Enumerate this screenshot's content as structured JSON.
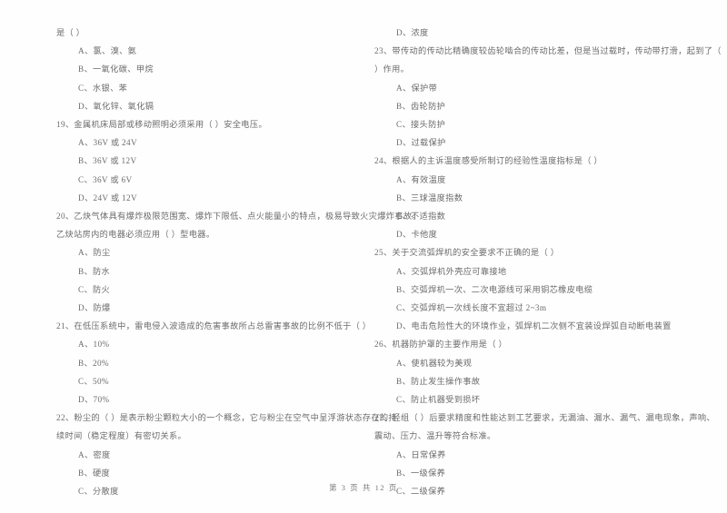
{
  "document": {
    "type": "exam-paper",
    "language": "zh-CN",
    "footer": "第 3 页 共 12 页"
  },
  "left_column": {
    "blocks": [
      {
        "id": "q18-tail",
        "kind": "stem-continuation",
        "text": "是（      ）"
      },
      {
        "id": "q18-a",
        "kind": "option",
        "text": "A、氯、溴、氨"
      },
      {
        "id": "q18-b",
        "kind": "option",
        "text": "B、一氧化碳、甲烷"
      },
      {
        "id": "q18-c",
        "kind": "option",
        "text": "C、水银、苯"
      },
      {
        "id": "q18-d",
        "kind": "option",
        "text": "D、氧化锌、氧化镉"
      },
      {
        "id": "q19-stem",
        "kind": "stem",
        "text": "19、金属机床局部或移动照明必须采用（      ）安全电压。"
      },
      {
        "id": "q19-a",
        "kind": "option",
        "text": "A、36V 或 24V"
      },
      {
        "id": "q19-b",
        "kind": "option",
        "text": "B、36V 或 12V"
      },
      {
        "id": "q19-c",
        "kind": "option",
        "text": "C、36V 或 6V"
      },
      {
        "id": "q19-d",
        "kind": "option",
        "text": "D、24V 或 12V"
      },
      {
        "id": "q20-stem",
        "kind": "stem",
        "text": "20、乙炔气体具有爆炸极限范围宽、爆炸下限低、点火能量小的特点，极易导致火灾爆炸事故。"
      },
      {
        "id": "q20-stem2",
        "kind": "stem-continuation",
        "text": "乙炔站房内的电器必须应用（      ）型电器。"
      },
      {
        "id": "q20-a",
        "kind": "option",
        "text": "A、防尘"
      },
      {
        "id": "q20-b",
        "kind": "option",
        "text": "B、防水"
      },
      {
        "id": "q20-c",
        "kind": "option",
        "text": "C、防火"
      },
      {
        "id": "q20-d",
        "kind": "option",
        "text": "D、防爆"
      },
      {
        "id": "q21-stem",
        "kind": "stem",
        "text": "21、在低压系统中，雷电侵入波造成的危害事故所占总雷害事故的比例不低于（      ）"
      },
      {
        "id": "q21-a",
        "kind": "option",
        "text": "A、10%"
      },
      {
        "id": "q21-b",
        "kind": "option",
        "text": "B、20%"
      },
      {
        "id": "q21-c",
        "kind": "option",
        "text": "C、50%"
      },
      {
        "id": "q21-d",
        "kind": "option",
        "text": "D、70%"
      },
      {
        "id": "q22-stem",
        "kind": "stem",
        "text": "22、粉尘的（      ）是表示粉尘颗粒大小的一个概念，它与粉尘在空气中呈浮游状态存在的持"
      },
      {
        "id": "q22-stem2",
        "kind": "stem-continuation",
        "text": "续时间（稳定程度）有密切关系。"
      },
      {
        "id": "q22-a",
        "kind": "option",
        "text": "A、密度"
      },
      {
        "id": "q22-b",
        "kind": "option",
        "text": "B、硬度"
      },
      {
        "id": "q22-c",
        "kind": "option",
        "text": "C、分散度"
      }
    ]
  },
  "right_column": {
    "blocks": [
      {
        "id": "q22-d",
        "kind": "option",
        "text": "D、浓度"
      },
      {
        "id": "q23-stem",
        "kind": "stem",
        "text": "23、带传动的传动比精确度较齿轮啮合的传动比差，但是当过载时，传动带打滑，起到了（"
      },
      {
        "id": "q23-stem2",
        "kind": "stem-continuation",
        "text": "）作用。"
      },
      {
        "id": "q23-a",
        "kind": "option",
        "text": "A、保护带"
      },
      {
        "id": "q23-b",
        "kind": "option",
        "text": "B、齿轮防护"
      },
      {
        "id": "q23-c",
        "kind": "option",
        "text": "C、接头防护"
      },
      {
        "id": "q23-d",
        "kind": "option",
        "text": "D、过载保护"
      },
      {
        "id": "q24-stem",
        "kind": "stem",
        "text": "24、根据人的主诉温度感受所制订的经验性温度指标是（      ）"
      },
      {
        "id": "q24-a",
        "kind": "option",
        "text": "A、有效温度"
      },
      {
        "id": "q24-b",
        "kind": "option",
        "text": "B、三球温度指数"
      },
      {
        "id": "q24-c",
        "kind": "option",
        "text": "C、不适指数"
      },
      {
        "id": "q24-d",
        "kind": "option",
        "text": "D、卡他度"
      },
      {
        "id": "q25-stem",
        "kind": "stem",
        "text": "25、关于交流弧焊机的安全要求不正确的是（      ）"
      },
      {
        "id": "q25-a",
        "kind": "option",
        "text": "A、交弧焊机外壳应可靠接地"
      },
      {
        "id": "q25-b",
        "kind": "option",
        "text": "B、交弧焊机一次、二次电源线可采用铜芯橡皮电缆"
      },
      {
        "id": "q25-c",
        "kind": "option",
        "text": "C、交弧焊机一次线长度不宜超过 2~3m"
      },
      {
        "id": "q25-d",
        "kind": "option",
        "text": "D、电击危险性大的环境作业，弧焊机二次侧不宜装设焊弧自动断电装置"
      },
      {
        "id": "q26-stem",
        "kind": "stem",
        "text": "26、机器防护罩的主要作用是（      ）"
      },
      {
        "id": "q26-a",
        "kind": "option",
        "text": "A、使机器较为美观"
      },
      {
        "id": "q26-b",
        "kind": "option",
        "text": "B、防止发生操作事故"
      },
      {
        "id": "q26-c",
        "kind": "option",
        "text": "C、防止机器受到损坏"
      },
      {
        "id": "q27-stem",
        "kind": "stem",
        "text": "27、经组（      ）后要求精度和性能达到工艺要求，无漏油、漏水、漏气、漏电现象，声响、"
      },
      {
        "id": "q27-stem2",
        "kind": "stem-continuation",
        "text": "震动、压力、温升等符合标准。"
      },
      {
        "id": "q27-a",
        "kind": "option",
        "text": "A、日常保养"
      },
      {
        "id": "q27-b",
        "kind": "option",
        "text": "B、一级保养"
      },
      {
        "id": "q27-c",
        "kind": "option",
        "text": "C、二级保养"
      }
    ]
  }
}
